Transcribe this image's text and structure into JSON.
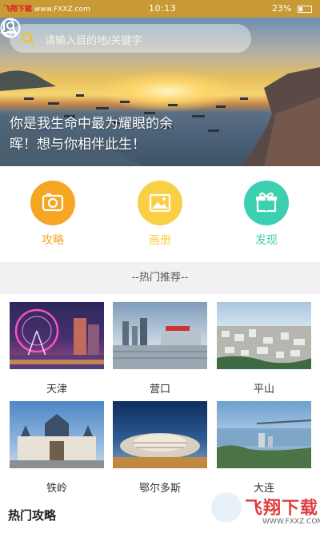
{
  "status": {
    "watermark_prefix": "飞翔下载",
    "watermark_url": "www.FXXZ.com",
    "time": "10:13",
    "battery": "23%"
  },
  "search": {
    "placeholder": "请输入目的地/关键字"
  },
  "hero": {
    "line1": "你是我生命中最为耀眼的余",
    "line2": "晖！想与你相伴此生！"
  },
  "categories": [
    {
      "label": "攻略",
      "color": "#f5a623",
      "icon": "camera-icon"
    },
    {
      "label": "画册",
      "color": "#f9cf45",
      "icon": "image-icon"
    },
    {
      "label": "发现",
      "color": "#3ccfb0",
      "icon": "gift-icon"
    }
  ],
  "section_recommend": "--热门推荐--",
  "destinations": [
    {
      "name": "天津"
    },
    {
      "name": "营口"
    },
    {
      "name": "平山"
    },
    {
      "name": "铁岭"
    },
    {
      "name": "鄂尔多斯"
    },
    {
      "name": "大连"
    }
  ],
  "section_guides": "热门攻略",
  "watermark": {
    "title": "飞翔下载",
    "url": "WWW.FXXZ.COM"
  }
}
